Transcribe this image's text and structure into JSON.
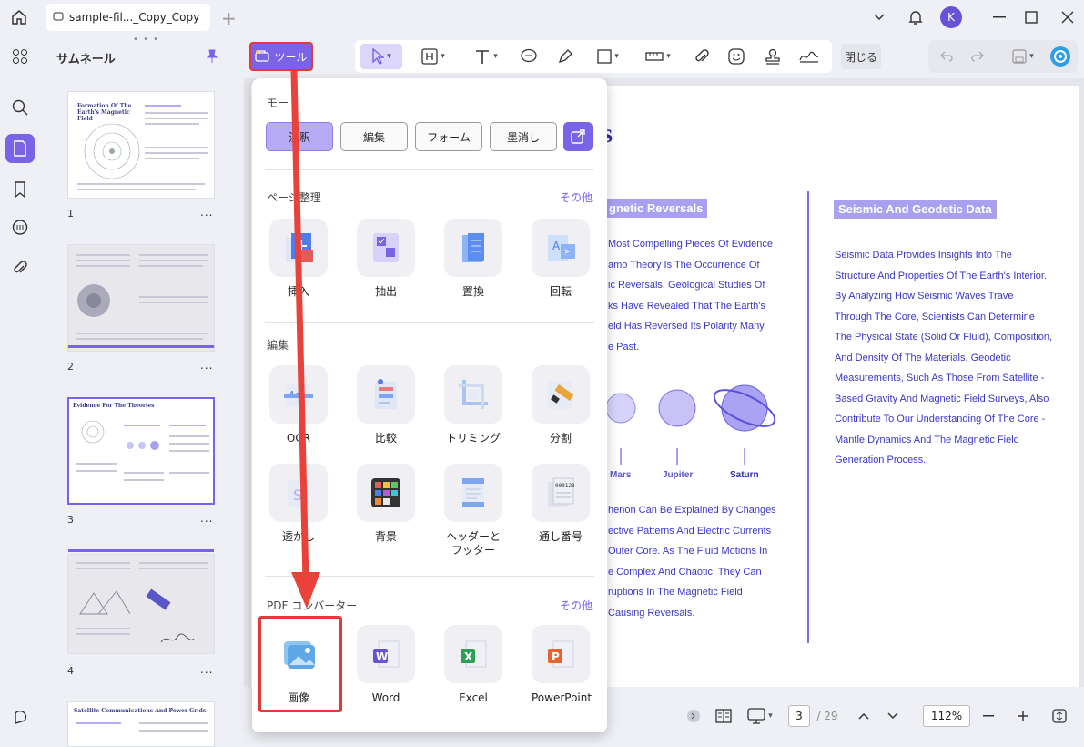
{
  "titlebar": {
    "tab_title": "sample-fil..._Copy_Copy",
    "avatar_letter": "K"
  },
  "thumbnails": {
    "title": "サムネール",
    "pages": [
      {
        "num": "1",
        "heading": "Formation Of The Earth's Magnetic Field"
      },
      {
        "num": "2",
        "heading": ""
      },
      {
        "num": "3",
        "heading": "Evidence For The Theories"
      },
      {
        "num": "4",
        "heading": ""
      },
      {
        "num": "",
        "heading": "Satellite Communications And Power Grids"
      }
    ],
    "more": "..."
  },
  "toolbar": {
    "tools_label": "ツール",
    "close_label": "閉じる"
  },
  "dropdown": {
    "mode_label": "モード",
    "modes": [
      "注釈",
      "編集",
      "フォーム",
      "墨消し"
    ],
    "sections": {
      "page": {
        "title": "ページ整理",
        "more": "その他",
        "items": [
          "挿入",
          "抽出",
          "置換",
          "回転"
        ]
      },
      "edit": {
        "title": "編集",
        "items": [
          "OCR",
          "比較",
          "トリミング",
          "分割",
          "透かし",
          "背景",
          "ヘッダーとフッター",
          "通し番号"
        ]
      },
      "convert": {
        "title": "PDF コンバーター",
        "more": "その他",
        "items": [
          "画像",
          "Word",
          "Excel",
          "PowerPoint"
        ]
      }
    }
  },
  "document": {
    "title_fragment": "es",
    "left_heading": "gnetic Reversals",
    "left_paragraph1": [
      "Most Compelling Pieces Of Evidence",
      "amo Theory Is The Occurrence Of",
      "ic Reversals. Geological Studies Of",
      "ks Have Revealed That The Earth's",
      "eld Has Reversed Its Polarity Many",
      "e Past."
    ],
    "planets": [
      "Mars",
      "Jupiter",
      "Saturn"
    ],
    "left_paragraph2": [
      "henon Can Be Explained By Changes",
      "ective Patterns And Electric Currents",
      "Outer Core. As The Fluid Motions In",
      "e Complex And Chaotic, They Can",
      "ruptions In The Magnetic Field",
      "Causing Reversals."
    ],
    "right_heading": "Seismic And Geodetic Data",
    "right_paragraph": [
      "Seismic Data Provides Insights Into The",
      "Structure And Properties Of The Earth's Interior.",
      "By Analyzing How Seismic Waves Trave",
      "Through The Core, Scientists Can Determine",
      "The Physical State (Solid Or Fluid), Composition,",
      "And Density Of The Materials. Geodetic",
      "Measurements, Such As Those From Satellite -",
      "Based Gravity And Magnetic Field Surveys, Also",
      "Contribute To Our Understanding Of The Core -",
      "Mantle Dynamics And The Magnetic Field",
      "Generation Process."
    ]
  },
  "statusbar": {
    "current_page": "3",
    "total_pages": "/ 29",
    "zoom": "112%"
  },
  "colors": {
    "accent": "#7a63e6",
    "highlight": "#e03a3a",
    "doc_text": "#3a36c8"
  }
}
